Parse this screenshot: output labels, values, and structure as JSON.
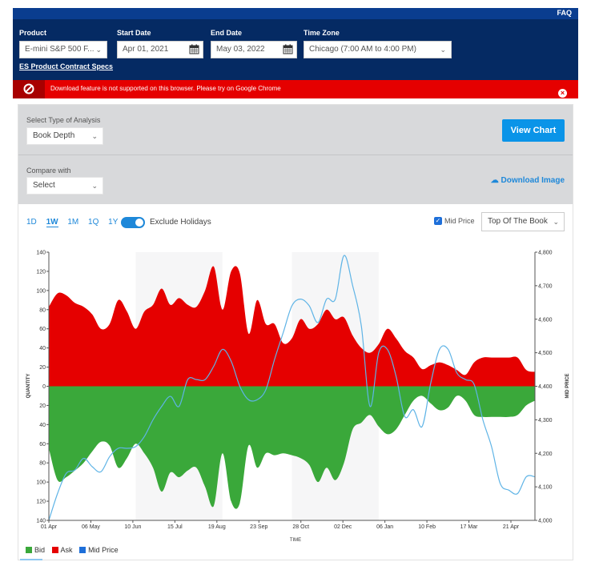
{
  "topbar": {
    "faq_label": "FAQ"
  },
  "filters": {
    "product": {
      "label": "Product",
      "value": "E-mini S&P 500 F...",
      "specs_link": "ES Product Contract Specs"
    },
    "start_date": {
      "label": "Start Date",
      "value": "Apr 01, 2021"
    },
    "end_date": {
      "label": "End Date",
      "value": "May 03, 2022"
    },
    "time_zone": {
      "label": "Time Zone",
      "value": "Chicago (7:00 AM to 4:00 PM)"
    }
  },
  "alert": {
    "message": "Download feature is not supported on this browser. Please try on Google Chrome",
    "color": "#e50000"
  },
  "analysis": {
    "type_label": "Select Type of Analysis",
    "type_value": "Book Depth",
    "view_chart_label": "View Chart",
    "compare_label": "Compare with",
    "compare_value": "Select",
    "download_label": "Download Image"
  },
  "controls": {
    "ranges": [
      "1D",
      "1W",
      "1M",
      "1Q",
      "1Y"
    ],
    "active_range": "1W",
    "exclude_holidays_label": "Exclude Holidays",
    "exclude_holidays_on": true,
    "mid_price_label": "Mid Price",
    "mid_price_checked": true,
    "book_level": "Top Of The Book"
  },
  "legend": [
    {
      "label": "Bid",
      "color": "#3aa83a"
    },
    {
      "label": "Ask",
      "color": "#e50000"
    },
    {
      "label": "Mid Price",
      "color": "#1e6fd9"
    }
  ],
  "chart_data": {
    "type": "area",
    "xlabel": "TIME",
    "ylabel_left": "QUANTITY",
    "ylabel_right": "MID PRICE",
    "x_ticks": [
      "01 Apr",
      "06 May",
      "10 Jun",
      "15 Jul",
      "19 Aug",
      "23 Sep",
      "28 Oct",
      "02 Dec",
      "06 Jan",
      "10 Feb",
      "17 Mar",
      "21 Apr"
    ],
    "x_range_weeks": [
      0,
      56
    ],
    "y_left_ticks": [
      "140",
      "120",
      "100",
      "80",
      "60",
      "40",
      "20",
      "0",
      "20",
      "40",
      "60",
      "80",
      "100",
      "120",
      "140"
    ],
    "y_left_range": [
      -140,
      140
    ],
    "y_right_ticks": [
      "4,800",
      "4,700",
      "4,600",
      "4,500",
      "4,400",
      "4,300",
      "4,200",
      "4,100",
      "4,000"
    ],
    "y_right_range": [
      4000,
      4800
    ],
    "shaded_bands_weeks": [
      [
        10,
        20
      ],
      [
        28,
        38
      ]
    ],
    "series": [
      {
        "name": "Ask",
        "color": "#e50000",
        "x": [
          0,
          1,
          2,
          3,
          4,
          5,
          6,
          7,
          8,
          9,
          10,
          11,
          12,
          13,
          14,
          15,
          16,
          17,
          18,
          19,
          20,
          21,
          22,
          23,
          24,
          25,
          26,
          27,
          28,
          29,
          30,
          31,
          32,
          33,
          34,
          35,
          36,
          37,
          38,
          39,
          40,
          41,
          42,
          43,
          44,
          45,
          46,
          47,
          48,
          49,
          50,
          51,
          52,
          53,
          54,
          55,
          56
        ],
        "values": [
          83,
          97,
          95,
          87,
          83,
          75,
          60,
          65,
          90,
          78,
          60,
          78,
          85,
          102,
          85,
          92,
          85,
          83,
          100,
          125,
          80,
          120,
          118,
          55,
          90,
          65,
          65,
          45,
          50,
          70,
          60,
          65,
          80,
          70,
          72,
          53,
          40,
          35,
          44,
          60,
          50,
          37,
          30,
          18,
          22,
          25,
          22,
          17,
          12,
          25,
          30,
          30,
          30,
          30,
          30,
          17,
          15
        ]
      },
      {
        "name": "Bid",
        "color": "#3aa83a",
        "x": [
          0,
          1,
          2,
          3,
          4,
          5,
          6,
          7,
          8,
          9,
          10,
          11,
          12,
          13,
          14,
          15,
          16,
          17,
          18,
          19,
          20,
          21,
          22,
          23,
          24,
          25,
          26,
          27,
          28,
          29,
          30,
          31,
          32,
          33,
          34,
          35,
          36,
          37,
          38,
          39,
          40,
          41,
          42,
          43,
          44,
          45,
          46,
          47,
          48,
          49,
          50,
          51,
          52,
          53,
          54,
          55,
          56
        ],
        "values": [
          -65,
          -98,
          -95,
          -88,
          -80,
          -68,
          -58,
          -62,
          -85,
          -75,
          -60,
          -70,
          -85,
          -110,
          -90,
          -95,
          -88,
          -85,
          -105,
          -125,
          -70,
          -120,
          -122,
          -62,
          -85,
          -70,
          -72,
          -70,
          -72,
          -75,
          -82,
          -100,
          -85,
          -98,
          -80,
          -45,
          -38,
          -30,
          -42,
          -50,
          -45,
          -30,
          -15,
          -10,
          -18,
          -25,
          -22,
          -10,
          -15,
          -30,
          -32,
          -32,
          -32,
          -32,
          -30,
          -20,
          -15
        ]
      },
      {
        "name": "Mid Price",
        "color": "#5fb4e6",
        "axis": "right",
        "x": [
          0,
          1,
          2,
          3,
          4,
          5,
          6,
          7,
          8,
          9,
          10,
          11,
          12,
          13,
          14,
          15,
          16,
          17,
          18,
          19,
          20,
          21,
          22,
          23,
          24,
          25,
          26,
          27,
          28,
          29,
          30,
          31,
          32,
          33,
          34,
          35,
          36,
          37,
          38,
          39,
          40,
          41,
          42,
          43,
          44,
          45,
          46,
          47,
          48,
          49,
          50,
          51,
          52,
          53,
          54,
          55,
          56
        ],
        "values": [
          4000,
          4080,
          4140,
          4150,
          4185,
          4160,
          4145,
          4190,
          4215,
          4215,
          4220,
          4250,
          4300,
          4340,
          4370,
          4340,
          4420,
          4420,
          4420,
          4460,
          4510,
          4475,
          4400,
          4360,
          4360,
          4390,
          4480,
          4560,
          4640,
          4660,
          4640,
          4590,
          4660,
          4660,
          4790,
          4700,
          4580,
          4340,
          4500,
          4510,
          4430,
          4310,
          4330,
          4280,
          4410,
          4510,
          4510,
          4440,
          4420,
          4405,
          4300,
          4220,
          4110,
          4090,
          4080,
          4130,
          4130
        ]
      }
    ]
  }
}
